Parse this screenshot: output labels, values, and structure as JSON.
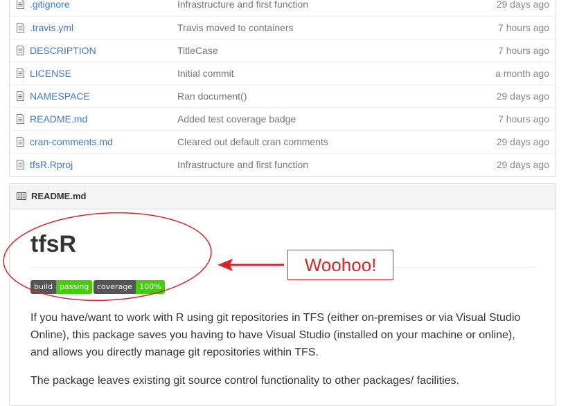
{
  "files": [
    {
      "name": ".gitignore",
      "message": "Infrastructure and first function",
      "age": "29 days ago"
    },
    {
      "name": ".travis.yml",
      "message": "Travis moved to containers",
      "age": "7 hours ago"
    },
    {
      "name": "DESCRIPTION",
      "message": "TitleCase",
      "age": "7 hours ago"
    },
    {
      "name": "LICENSE",
      "message": "Initial commit",
      "age": "a month ago"
    },
    {
      "name": "NAMESPACE",
      "message": "Ran document()",
      "age": "29 days ago"
    },
    {
      "name": "README.md",
      "message": "Added test coverage badge",
      "age": "7 hours ago"
    },
    {
      "name": "cran-comments.md",
      "message": "Cleared out default cran comments",
      "age": "29 days ago"
    },
    {
      "name": "tfsR.Rproj",
      "message": "Infrastructure and first function",
      "age": "29 days ago"
    }
  ],
  "readme": {
    "header_title": "README.md",
    "title": "tfsR",
    "badges": [
      {
        "label": "build",
        "value": "passing",
        "color": "#44cc11"
      },
      {
        "label": "coverage",
        "value": "100%",
        "color": "#44cc11"
      }
    ],
    "paragraph1": "If you have/want to work with R using git repositories in TFS (either on-premises or via Visual Studio Online), this package saves you having to have Visual Studio (installed on your machine or online), and allows you directly manage git repositories within TFS.",
    "paragraph2": "The package leaves existing git source control functionality to other packages/ facilities."
  },
  "annotation": {
    "callout_text": "Woohoo!",
    "color": "#d9262a"
  },
  "icons": {
    "file": "file-icon",
    "readme": "book-icon"
  }
}
